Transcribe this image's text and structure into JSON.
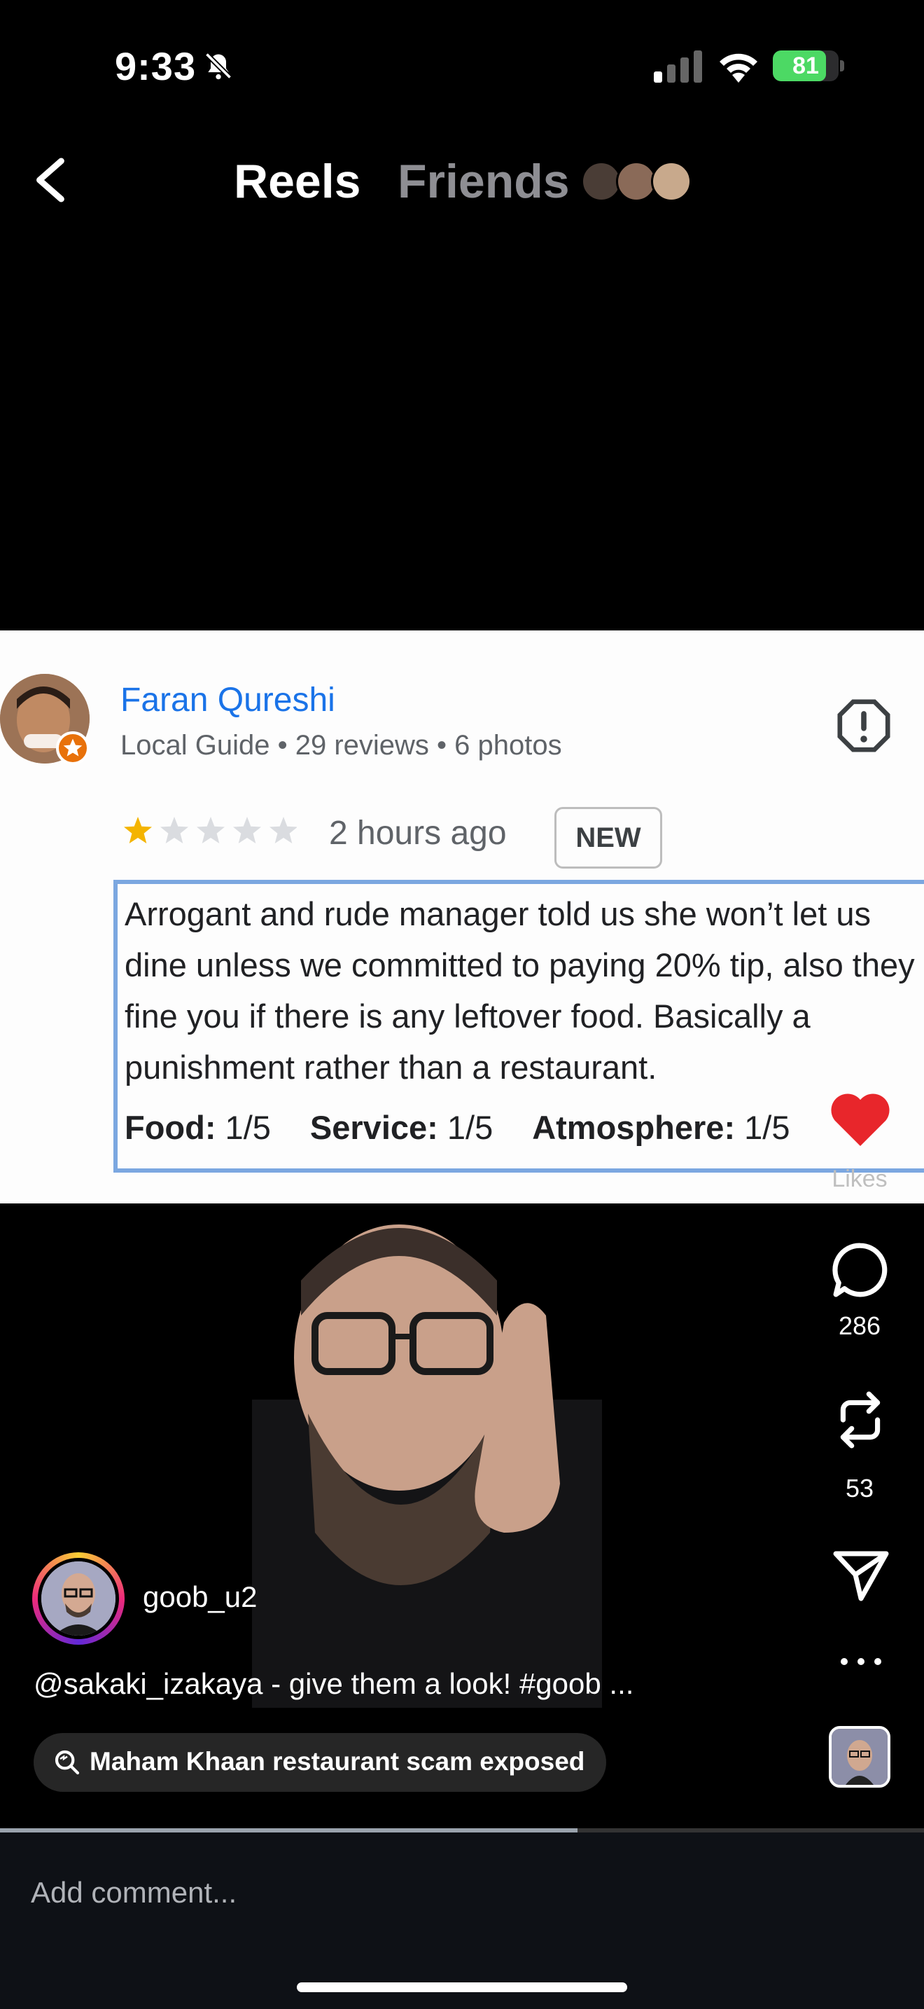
{
  "status_bar": {
    "time": "9:33",
    "battery": "81",
    "battery_level": 0.81,
    "icons": [
      "bell-slash-icon",
      "cellular-signal-icon",
      "wifi-icon",
      "battery-charging-icon"
    ]
  },
  "header": {
    "back_icon": "chevron-left-icon",
    "tabs": [
      {
        "label": "Reels",
        "active": true
      },
      {
        "label": "Friends",
        "active": false
      }
    ]
  },
  "review": {
    "reviewer_name": "Faran Qureshi",
    "reviewer_meta": "Local Guide • 29 reviews • 6 photos",
    "rating": 1,
    "rating_max": 5,
    "time_ago": "2 hours ago",
    "badge": "NEW",
    "body": "Arrogant and rude manager told us she won’t let us dine unless we committed to paying 20% tip, also they fine you if there is any leftover food. Basically a punishment rather than a restaurant.",
    "scores": {
      "food_label": "Food:",
      "food_value": " 1/5",
      "service_label": "Service:",
      "service_value": " 1/5",
      "atmosphere_label": "Atmosphere:",
      "atmosphere_value": " 1/5"
    }
  },
  "actions": {
    "likes_label": "Likes",
    "comments": "286",
    "reposts": "53"
  },
  "post": {
    "username": "goob_u2",
    "caption": "@sakaki_izakaya - give them a look! #goob ...",
    "search_suggestion": "Maham Khaan restaurant scam exposed",
    "playback_progress": 0.625
  },
  "comment": {
    "placeholder": "Add comment..."
  },
  "colors": {
    "background": "#000000",
    "link_blue": "#1a73e8",
    "heart_red": "#e8262b",
    "star_gold": "#f4b400",
    "review_border": "#7ba7e0",
    "battery_green": "#4cd964"
  }
}
